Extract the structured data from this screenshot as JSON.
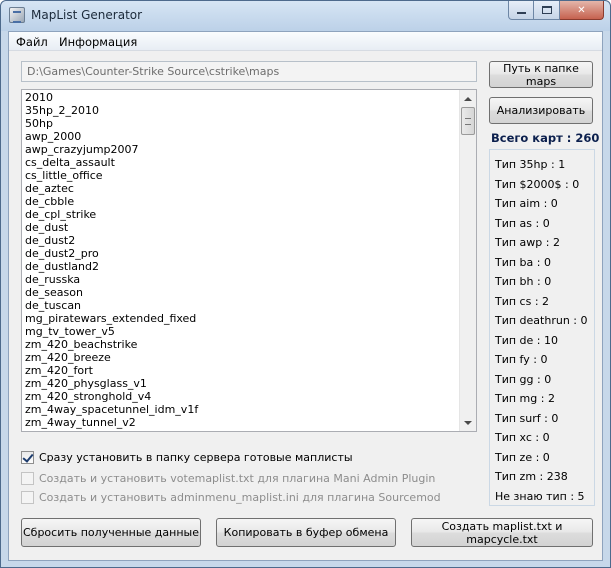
{
  "window": {
    "title": "MapList Generator"
  },
  "menu": [
    "Файл",
    "Информация"
  ],
  "path": {
    "value": "D:\\Games\\Counter-Strike Source\\cstrike\\maps"
  },
  "buttons": {
    "path_folder": "Путь к папке maps",
    "analyze": "Анализировать",
    "reset": "Сбросить полученные данные",
    "copy": "Копировать в буфер обмена",
    "create": "Создать maplist.txt и mapcycle.txt"
  },
  "maps": [
    "2010",
    "35hp_2_2010",
    "50hp",
    "awp_2000",
    "awp_crazyjump2007",
    "cs_delta_assault",
    "cs_little_office",
    "de_aztec",
    "de_cbble",
    "de_cpl_strike",
    "de_dust",
    "de_dust2",
    "de_dust2_pro",
    "de_dustland2",
    "de_russka",
    "de_season",
    "de_tuscan",
    "mg_piratewars_extended_fixed",
    "mg_tv_tower_v5",
    "zm_420_beachstrike",
    "zm_420_breeze",
    "zm_420_fort",
    "zm_420_physglass_v1",
    "zm_420_stronghold_v4",
    "zm_4way_spacetunnel_idm_v1f",
    "zm_4way_tunnel_v2"
  ],
  "options": [
    {
      "label": "Сразу установить в папку сервера готовые маплисты",
      "checked": true,
      "enabled": true
    },
    {
      "label": "Создать и установить votemaplist.txt для плагина Mani Admin Plugin",
      "checked": false,
      "enabled": false
    },
    {
      "label": "Создать и установить adminmenu_maplist.ini для плагина Sourcemod",
      "checked": false,
      "enabled": false
    }
  ],
  "total": "Всего карт : 260",
  "stats": [
    "Тип 35hp : 1",
    "Тип $2000$ : 0",
    "Тип aim : 0",
    "Тип as : 0",
    "Тип awp : 2",
    "Тип ba : 0",
    "Тип bh : 0",
    "Тип cs : 2",
    "Тип deathrun : 0",
    "Тип de : 10",
    "Тип fy : 0",
    "Тип gg : 0",
    "Тип mg : 2",
    "Тип surf : 0",
    "Тип xc : 0",
    "Тип ze : 0",
    "Тип zm : 238",
    "Не знаю тип : 5"
  ]
}
